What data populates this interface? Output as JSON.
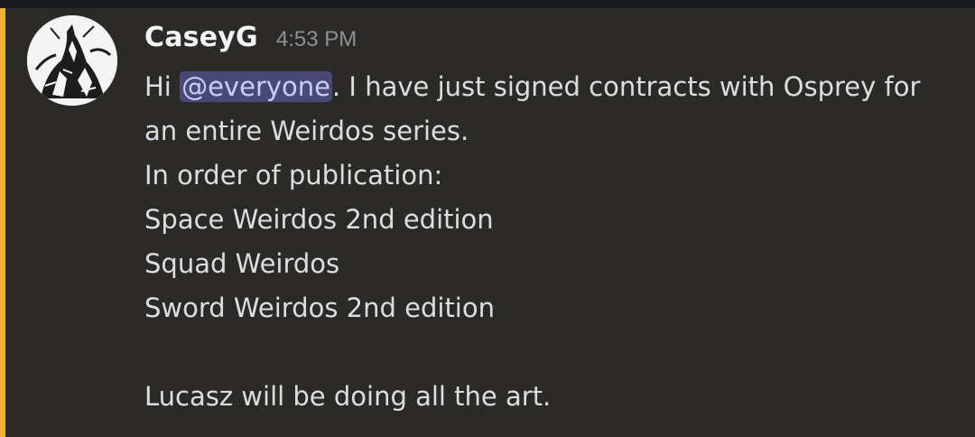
{
  "message": {
    "author": "CaseyG",
    "timestamp": "4:53 PM",
    "greeting": "Hi",
    "mention": "@everyone",
    "line1_rest": ". I have just signed contracts with Osprey for",
    "lines": [
      "an entire Weirdos series.",
      "In order of publication:",
      "Space Weirdos 2nd edition",
      "Squad Weirdos",
      "Sword Weirdos 2nd edition",
      "",
      "Lucasz will be doing all the art."
    ]
  },
  "colors": {
    "background": "#2c2a27",
    "mention_highlight": "#f0b232",
    "mention_pill": "#4a4975",
    "mention_text": "#c9cdfb",
    "username": "#f2f3f5",
    "timestamp": "#8e9099",
    "text": "#dbdee1"
  },
  "avatar": {
    "icon": "user-avatar-ink-drawing-icon"
  }
}
